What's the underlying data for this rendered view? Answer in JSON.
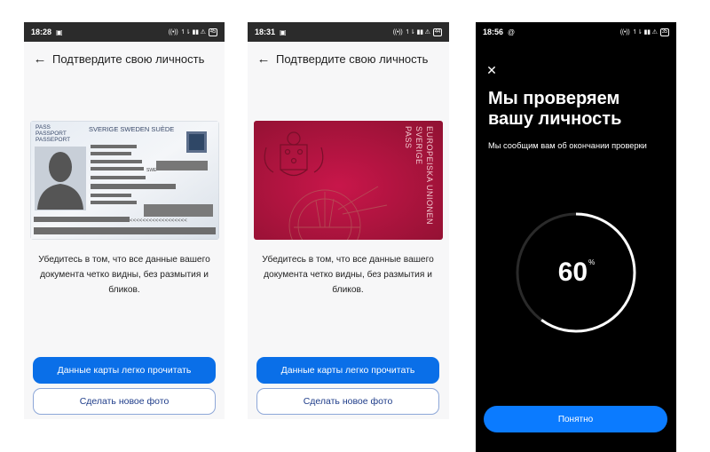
{
  "screens": [
    {
      "status": {
        "time": "18:28",
        "battery": "45"
      },
      "header": {
        "title": "Подтвердите свою личность"
      },
      "document": {
        "type": "id-card",
        "header_line1": "PASS",
        "header_line2": "PASSPORT",
        "header_line3": "PASSEPORT",
        "country": "SVERIGE  SWEDEN  SUÈDE",
        "code": "SWE",
        "mrz": "<<<<<<<<<<<<<<<<<<"
      },
      "instruction": "Убедитесь в том, что все данные вашего документа четко видны, без размытия и бликов.",
      "primary_button": "Данные карты легко прочитать",
      "secondary_button": "Сделать новое фото"
    },
    {
      "status": {
        "time": "18:31",
        "battery": "44"
      },
      "header": {
        "title": "Подтвердите свою личность"
      },
      "document": {
        "type": "passport-cover",
        "line1": "EUROPEISKA UNIONEN",
        "line2": "SVERIGE",
        "line3": "PASS"
      },
      "instruction": "Убедитесь в том, что все данные вашего документа четко видны, без размытия и бликов.",
      "primary_button": "Данные карты легко прочитать",
      "secondary_button": "Сделать новое фото"
    },
    {
      "status": {
        "time": "18:56",
        "battery": "35"
      },
      "title": "Мы проверяем вашу личность",
      "subtitle": "Мы сообщим вам об окончании проверки",
      "progress": {
        "value": "60",
        "unit": "%",
        "fraction": 0.6
      },
      "ok_button": "Понятно"
    }
  ],
  "colors": {
    "accent": "#0a6fe8",
    "passport_red": "#b0143c",
    "dark_bg": "#000000"
  }
}
